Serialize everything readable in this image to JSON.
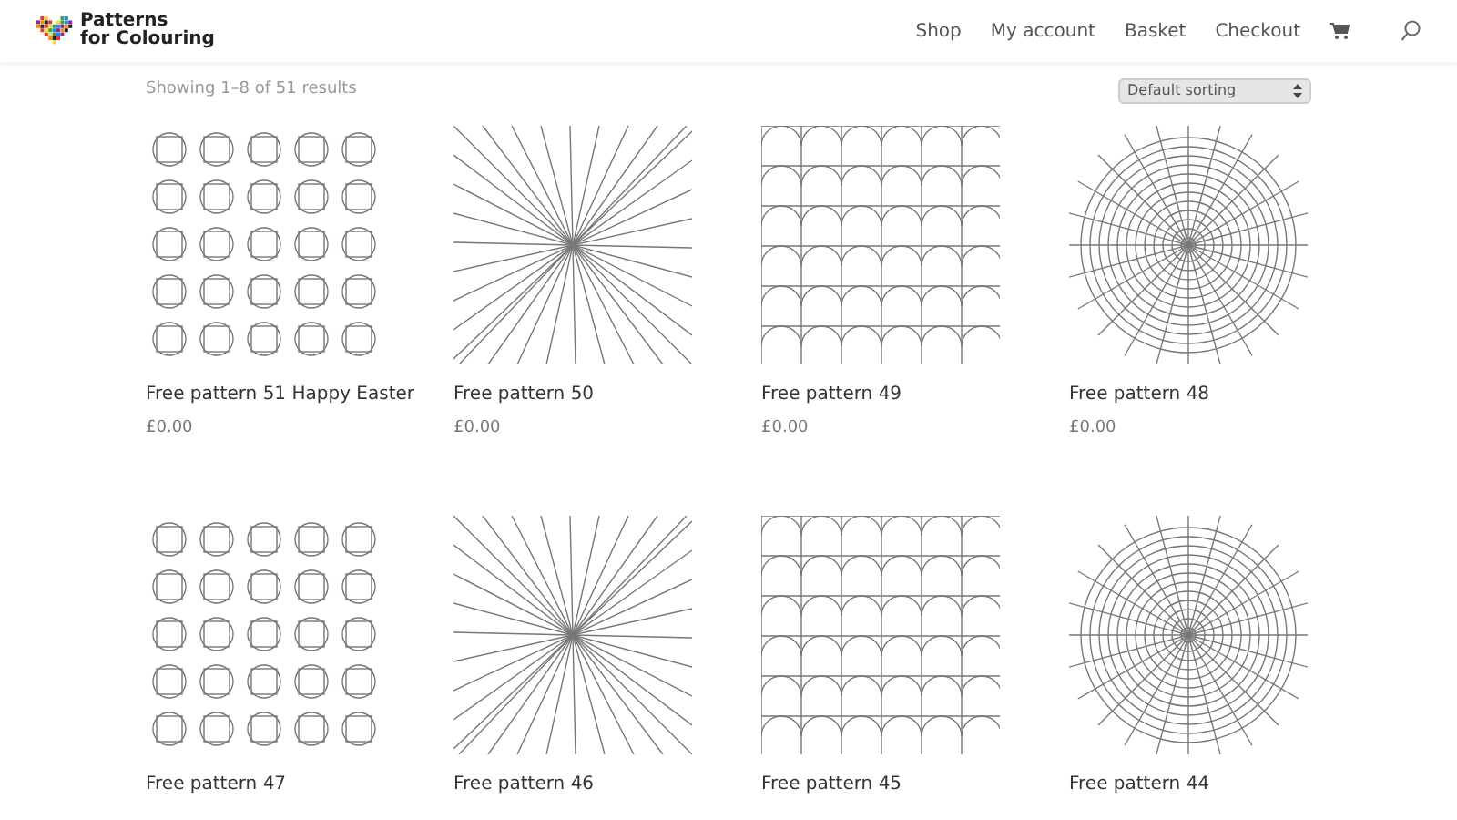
{
  "header": {
    "logo_text": [
      "Patterns",
      "for Colouring"
    ],
    "nav": [
      {
        "label": "Shop"
      },
      {
        "label": "My account"
      },
      {
        "label": "Basket"
      },
      {
        "label": "Checkout"
      }
    ]
  },
  "toolbar": {
    "result_count": "Showing 1–8 of 51 results",
    "sorting": "Default sorting"
  },
  "products": [
    {
      "title": "Free pattern 51 Happy Easter",
      "price": "£0.00"
    },
    {
      "title": "Free pattern 50",
      "price": "£0.00"
    },
    {
      "title": "Free pattern 49",
      "price": "£0.00"
    },
    {
      "title": "Free pattern 48",
      "price": "£0.00"
    },
    {
      "title": "Free pattern 47"
    },
    {
      "title": "Free pattern 46"
    },
    {
      "title": "Free pattern 45"
    },
    {
      "title": "Free pattern 44"
    }
  ]
}
